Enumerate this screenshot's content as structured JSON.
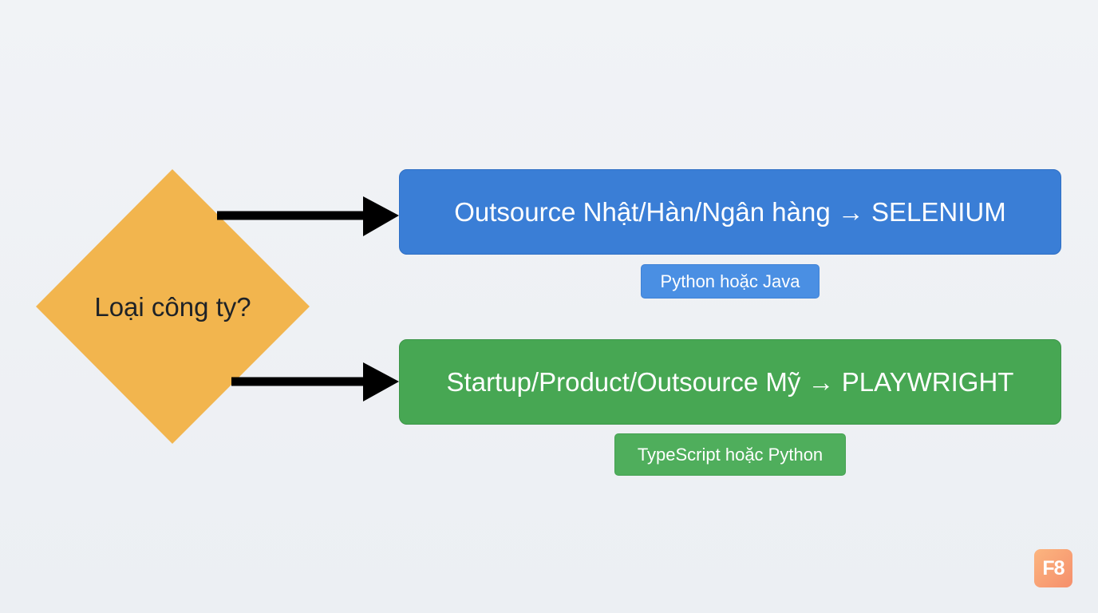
{
  "decision": {
    "label": "Loại công ty?",
    "color": "#f2b54e"
  },
  "outcomes": [
    {
      "label": "Outsource Nhật/Hàn/Ngân hàng → SELENIUM",
      "sublabel": "Python hoặc Java",
      "color": "#3a7ed6"
    },
    {
      "label": "Startup/Product/Outsource Mỹ → PLAYWRIGHT",
      "sublabel": "TypeScript hoặc Python",
      "color": "#47a753"
    }
  ],
  "logo": {
    "text": "F8"
  },
  "arrow_color": "#000000"
}
